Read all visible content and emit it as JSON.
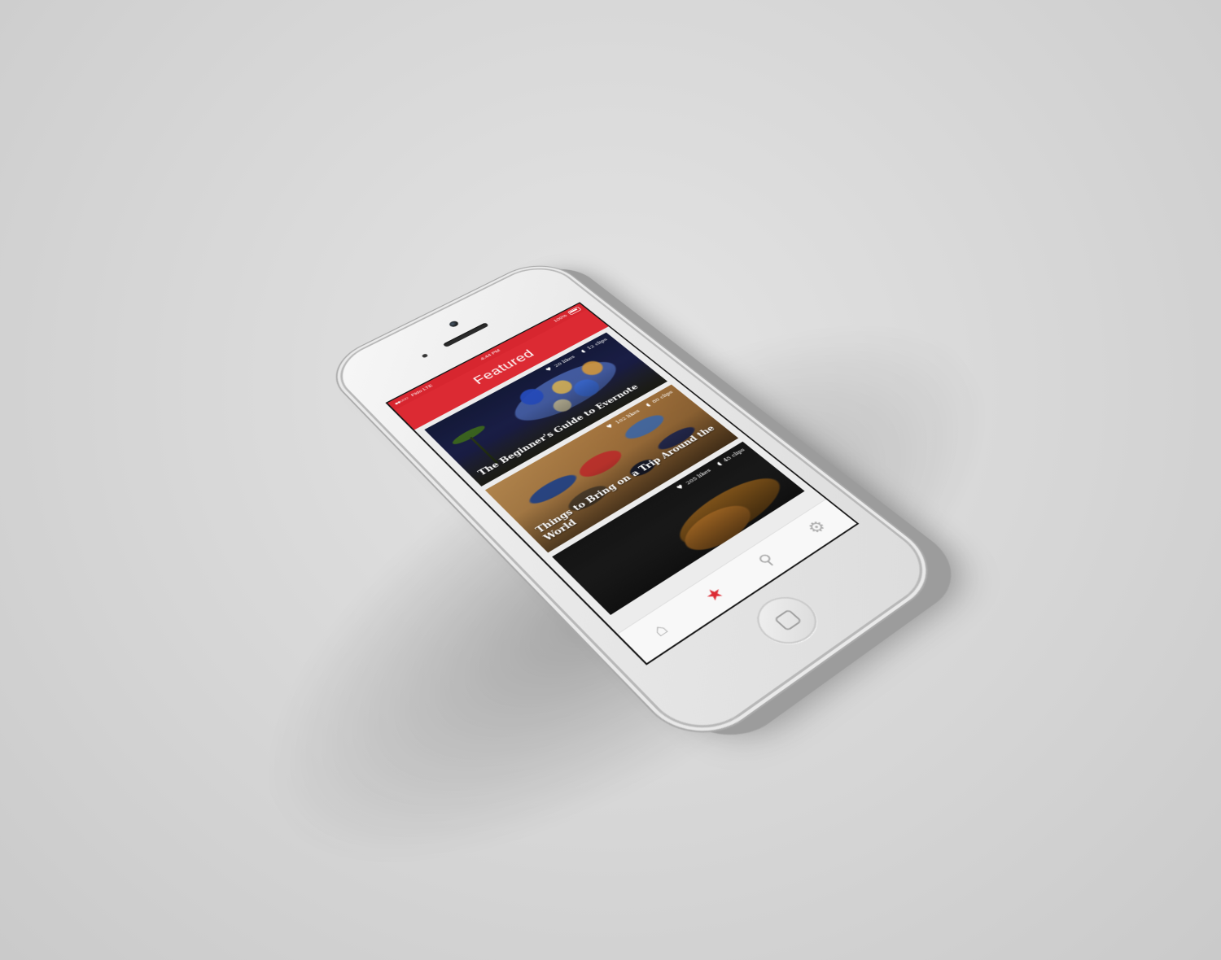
{
  "status_bar": {
    "carrier": "Fido LTE",
    "signal": "●●○○○",
    "time": "4:44 PM",
    "battery": "100%"
  },
  "nav": {
    "title": "Featured"
  },
  "cards": [
    {
      "title": "The Beginner's Guide to Evernote",
      "likes": "20 likes",
      "clips": "12 clips"
    },
    {
      "title": "Things to Bring on a Trip Around the World",
      "likes": "102 likes",
      "clips": "80 clips"
    },
    {
      "title": "",
      "likes": "205 likes",
      "clips": "45 clips"
    }
  ],
  "tabs": {
    "home_icon": "⌂",
    "featured_icon": "★",
    "search_icon": "⚲",
    "settings_icon": "⚙"
  },
  "colors": {
    "accent": "#dc2a33",
    "inactive_tab": "#a9a9a9"
  }
}
